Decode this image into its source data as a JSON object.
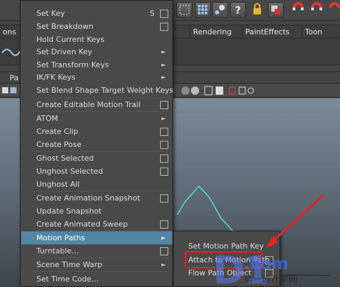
{
  "colors": {
    "menu_bg": "#494949",
    "highlight": "#5285a6",
    "annotation_red": "#e5231f",
    "viewport_curve": "#4fe0c8"
  },
  "toolbar": {
    "icons": [
      "select-icon",
      "snap-grid-icon",
      "snap-points-icon",
      "help-icon",
      "lock-icon",
      "render-icon",
      "magnet-icon",
      "magnet-alt-icon",
      "magnet-u-icon"
    ],
    "help_glyph": "?"
  },
  "tabs": [
    {
      "label": "ons"
    },
    {
      "label": "Rendering"
    },
    {
      "label": "PaintEffects"
    },
    {
      "label": "Toon"
    }
  ],
  "panel_bar": {
    "label": "Pa"
  },
  "menu": {
    "items": [
      {
        "label": "Set Key",
        "shortcut": "S",
        "option_box": true
      },
      {
        "label": "Set Breakdown",
        "option_box": true
      },
      {
        "label": "Hold Current Keys"
      },
      {
        "label": "Set Driven Key",
        "submenu": true
      },
      {
        "label": "Set Transform Keys",
        "submenu": true
      },
      {
        "label": "IK/FK Keys",
        "submenu": true
      },
      {
        "label": "Set Blend Shape Target Weight Keys"
      },
      {
        "label": "Create Editable Motion Trail",
        "option_box": true
      },
      {
        "label": "ATOM",
        "submenu": true
      },
      {
        "label": "Create Clip",
        "option_box": true
      },
      {
        "label": "Create Pose",
        "option_box": true
      },
      {
        "label": "Ghost Selected",
        "option_box": true
      },
      {
        "label": "Unghost Selected",
        "option_box": true
      },
      {
        "label": "Unghost All"
      },
      {
        "label": "Create Animation Snapshot",
        "option_box": true
      },
      {
        "label": "Update Snapshot"
      },
      {
        "label": "Create Animated Sweep",
        "option_box": true
      },
      {
        "label": "Motion Paths",
        "submenu": true,
        "highlighted": true
      },
      {
        "label": "Turntable...",
        "option_box": true
      },
      {
        "label": "Scene Time Warp",
        "submenu": true
      },
      {
        "label": "Set Time Code..."
      }
    ]
  },
  "submenu": {
    "items": [
      {
        "label": "Set Motion Path Key"
      },
      {
        "label": "Attach to Motion Path",
        "option_box": true
      },
      {
        "label": "Flow Path Object",
        "option_box": true
      }
    ]
  },
  "watermark": {
    "logo": "D1",
    "domain": ".com",
    "tagline": "第一设计学网"
  }
}
